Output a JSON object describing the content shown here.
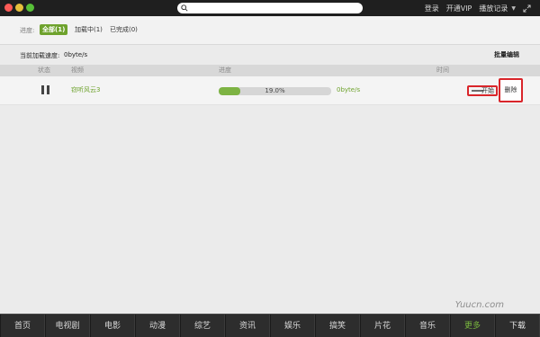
{
  "titlebar": {
    "search_placeholder": "",
    "links": {
      "login": "登录",
      "vip": "开通VIP",
      "history": "播放记录"
    }
  },
  "filters": {
    "label": "进度:",
    "all": "全部(1)",
    "loading": "加载中(1)",
    "done": "已完成(0)"
  },
  "speed": {
    "label": "当前加载速度:",
    "value": "0byte/s",
    "batch_edit": "批量编辑"
  },
  "table": {
    "headers": {
      "status": "状态",
      "video": "视频",
      "progress": "进度",
      "time": "时间"
    },
    "rows": [
      {
        "name": "窃听风云3",
        "percent_text": "19.0%",
        "progress": 0.19,
        "rate": "0byte/s",
        "start": "开始",
        "delete": "删除"
      }
    ]
  },
  "bottom_nav": [
    "首页",
    "电视剧",
    "电影",
    "动漫",
    "综艺",
    "资讯",
    "娱乐",
    "搞笑",
    "片花",
    "音乐",
    "更多",
    "下载"
  ],
  "watermark": "Yuucn.com",
  "colors": {
    "accent_green": "#6ea22d",
    "highlight_red": "#d9252a"
  }
}
